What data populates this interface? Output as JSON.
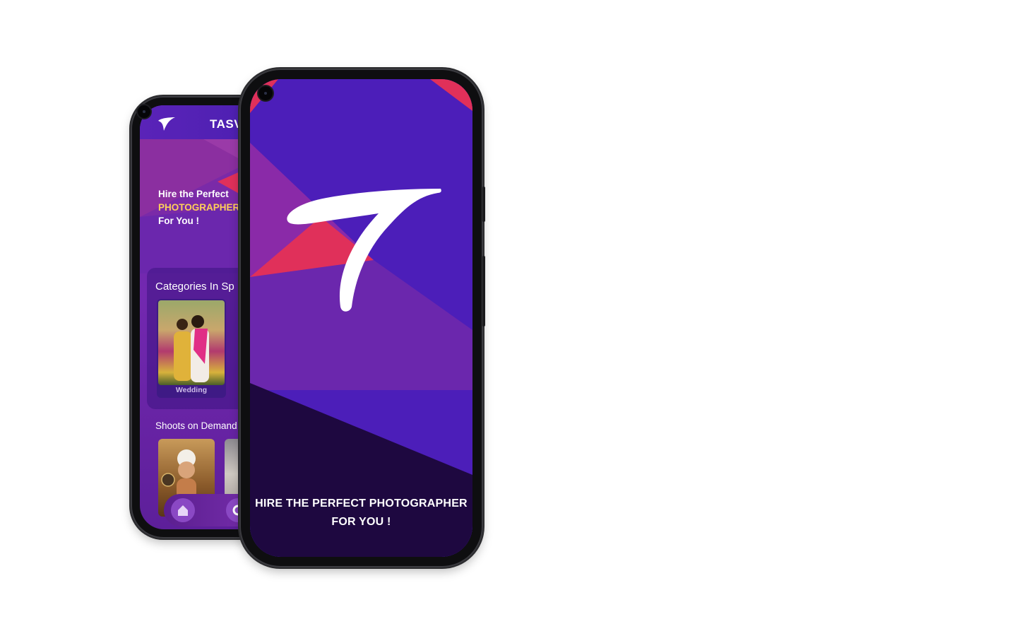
{
  "colors": {
    "splash_bg": "#4c1eb9",
    "accent_pink": "#e0305a",
    "accent_yellow": "#ffcf5a",
    "dark_bottom": "#1e0840"
  },
  "back_phone": {
    "brand": "TASV",
    "hero": {
      "line1": "Hire the Perfect",
      "line2": "PHOTOGRAPHER",
      "line3": "For You !"
    },
    "categories_title": "Categories In Sp",
    "categories": [
      {
        "label": "Wedding"
      }
    ],
    "shoots_title": "Shoots on Demand",
    "nav": [
      {
        "icon": "home-icon"
      },
      {
        "icon": "circle-icon"
      }
    ]
  },
  "front_phone": {
    "logo_icon": "tasveer-t-logo-icon",
    "caption_line1": "HIRE THE PERFECT PHOTOGRAPHER",
    "caption_line2": "FOR YOU !"
  }
}
